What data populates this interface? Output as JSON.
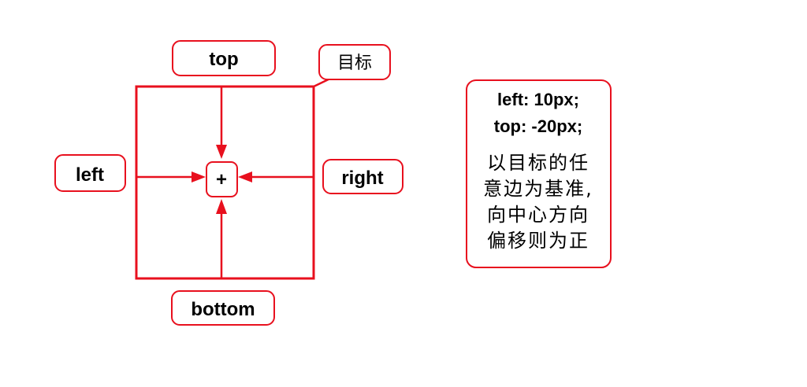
{
  "labels": {
    "top": "top",
    "left": "left",
    "right": "right",
    "bottom": "bottom",
    "center": "+",
    "target": "目标"
  },
  "info": {
    "code_line_1": "left: 10px;",
    "code_line_2": "top: -20px;",
    "desc_line_1": "以目标的任",
    "desc_line_2": "意边为基准,",
    "desc_line_3": "向中心方向",
    "desc_line_4": "偏移则为正"
  },
  "colors": {
    "accent": "#e8101e",
    "text": "#000000",
    "background": "#ffffff"
  }
}
